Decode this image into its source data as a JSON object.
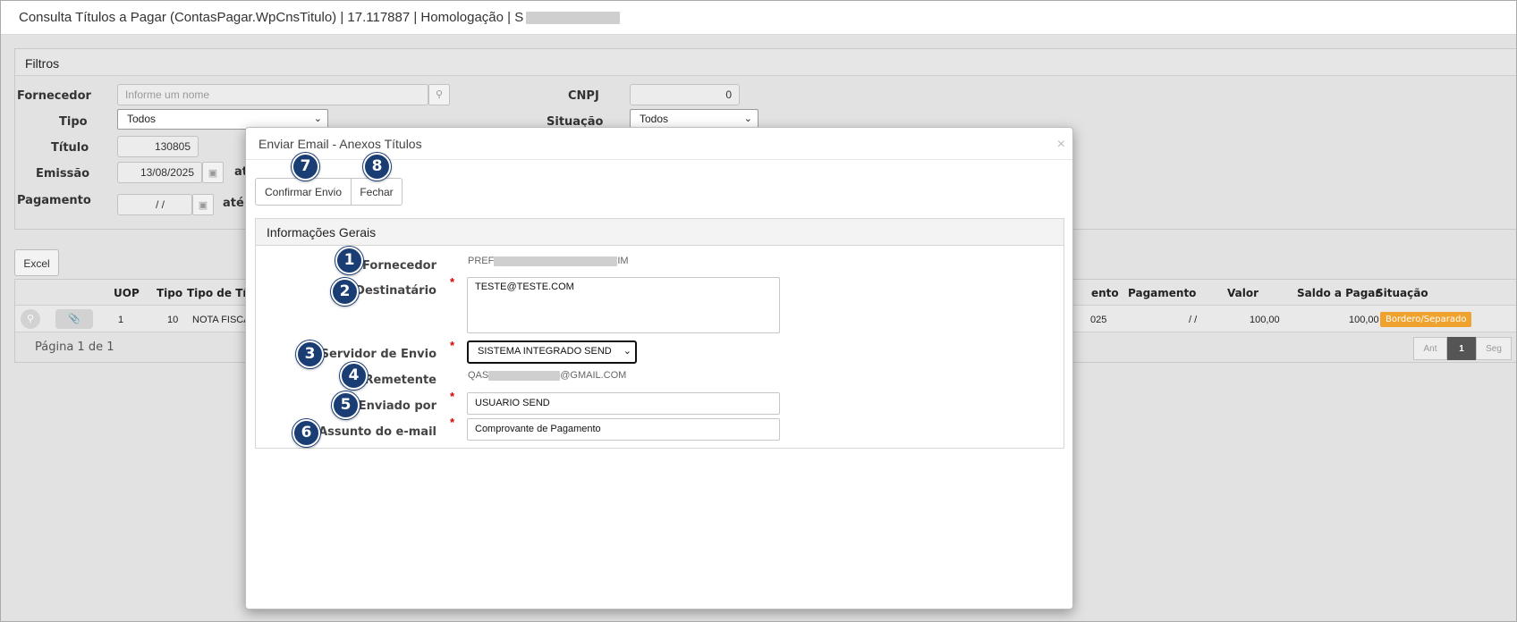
{
  "window": {
    "title": "Consulta Títulos a Pagar (ContasPagar.WpCnsTitulo) | 17.117887 | Homologação | S"
  },
  "filters": {
    "header": "Filtros",
    "fornecedor_label": "Fornecedor",
    "fornecedor_placeholder": "Informe um nome",
    "cnpj_label": "CNPJ",
    "cnpj_value": "0",
    "tipo_label": "Tipo",
    "tipo_value": "Todos",
    "situacao_label": "Situação",
    "situacao_value": "Todos",
    "titulo_label": "Título",
    "titulo_value": "130805",
    "emissao_label": "Emissão",
    "emissao_value": "13/08/2025",
    "ate_label": "até",
    "pagamento_label": "Pagamento",
    "pagamento_value": "/ /",
    "ate2_label": "até"
  },
  "toolbar": {
    "excel_label": "Excel"
  },
  "grid": {
    "headers": {
      "uop": "UOP",
      "tipo": "Tipo",
      "tipo_titulo": "Tipo de Títu",
      "vencimento": "ento",
      "pagamento": "Pagamento",
      "valor": "Valor",
      "saldo": "Saldo a Pagar",
      "situacao": "Situação"
    },
    "row": {
      "uop": "1",
      "tipo": "10",
      "tipo_titulo": "NOTA FISCA",
      "vencimento": "025",
      "pagamento": "/ /",
      "valor": "100,00",
      "saldo": "100,00",
      "situacao": "Bordero/Separado"
    },
    "page_info": "Página 1 de 1",
    "pager": {
      "prev": "Ant",
      "current": "1",
      "next": "Seg"
    }
  },
  "modal": {
    "title": "Enviar Email - Anexos Títulos",
    "close_glyph": "×",
    "confirm_label": "Confirmar Envio",
    "close_label": "Fechar",
    "section_title": "Informações Gerais",
    "fornecedor_label": "Fornecedor",
    "fornecedor_prefix": "PREF",
    "fornecedor_suffix": "IM",
    "destinatario_label": "Destinatário",
    "destinatario_value": "TESTE@TESTE.COM",
    "servidor_label": "Servidor de Envio",
    "servidor_value": "SISTEMA INTEGRADO SEND",
    "remetente_label": "Remetente",
    "remetente_prefix": "QAS",
    "remetente_suffix": "@GMAIL.COM",
    "enviado_label": "Enviado por",
    "enviado_value": "USUARIO SEND",
    "assunto_label": "Assunto do e-mail",
    "assunto_value": "Comprovante de Pagamento",
    "required_mark": "*"
  },
  "callouts": [
    "1",
    "2",
    "3",
    "4",
    "5",
    "6",
    "7",
    "8"
  ],
  "colors": {
    "callout": "#1a3d73",
    "badge": "#f0a22e",
    "required": "#dd0000"
  }
}
